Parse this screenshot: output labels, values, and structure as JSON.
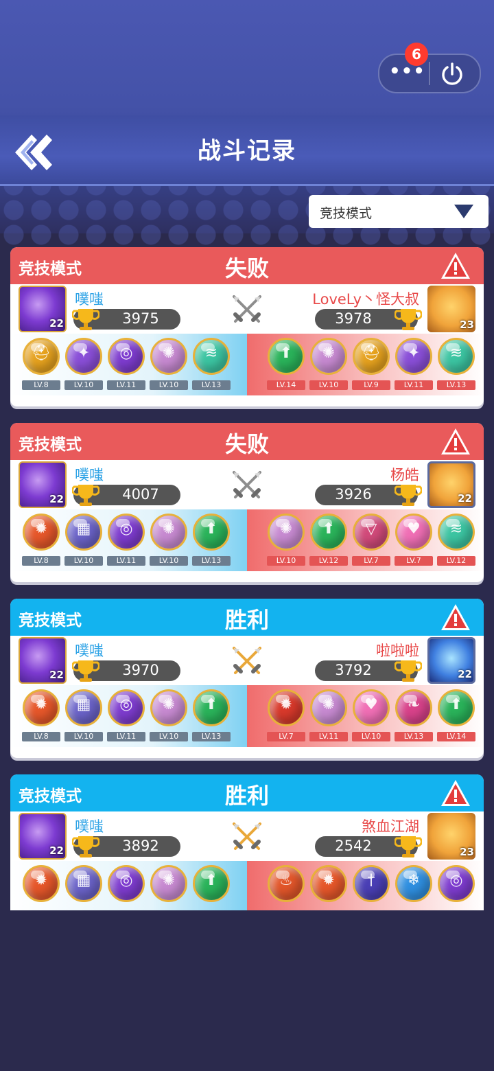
{
  "header": {
    "title": "战斗记录",
    "badge_count": "6"
  },
  "filter": {
    "selected": "竞技模式"
  },
  "colors": {
    "lose": "#e95a5b",
    "win": "#13b3ef"
  },
  "matches": [
    {
      "mode": "竞技模式",
      "result": "失败",
      "outcome": "lose",
      "me": {
        "name": "噗嗤",
        "trophies": "3975",
        "level": "22",
        "avatar": "purple-orb"
      },
      "opponent": {
        "name": "LoveLy丶怪大叔",
        "trophies": "3978",
        "level": "23",
        "avatar": "tiger"
      },
      "my_pets": [
        {
          "icon": "gold-helmet",
          "color": "#e6a21e",
          "lv": "LV.8"
        },
        {
          "icon": "purple-butterfly",
          "color": "#8a4fd8",
          "lv": "LV.10"
        },
        {
          "icon": "purple-swirl",
          "color": "#7e3ccf",
          "lv": "LV.11"
        },
        {
          "icon": "rainbow-figure",
          "color": "#c78ad1",
          "lv": "LV.10"
        },
        {
          "icon": "green-tornado",
          "color": "#3cc5a2",
          "lv": "LV.13"
        }
      ],
      "opp_pets": [
        {
          "icon": "green-arrow",
          "color": "#2ab35a",
          "lv": "LV.14"
        },
        {
          "icon": "rainbow-figure",
          "color": "#c78ad1",
          "lv": "LV.10"
        },
        {
          "icon": "gold-helmet",
          "color": "#e6a21e",
          "lv": "LV.9"
        },
        {
          "icon": "purple-butterfly",
          "color": "#8a4fd8",
          "lv": "LV.11"
        },
        {
          "icon": "green-tornado",
          "color": "#3cc5a2",
          "lv": "LV.13"
        }
      ]
    },
    {
      "mode": "竞技模式",
      "result": "失败",
      "outcome": "lose",
      "me": {
        "name": "噗嗤",
        "trophies": "4007",
        "level": "22",
        "avatar": "purple-orb"
      },
      "opponent": {
        "name": "杨皓",
        "trophies": "3926",
        "level": "22",
        "avatar": "tiger-framed"
      },
      "my_pets": [
        {
          "icon": "fire-phoenix",
          "color": "#e6572a",
          "lv": "LV.8"
        },
        {
          "icon": "stone-block",
          "color": "#6b63c9",
          "lv": "LV.10"
        },
        {
          "icon": "purple-swirl",
          "color": "#7e3ccf",
          "lv": "LV.11"
        },
        {
          "icon": "rainbow-figure",
          "color": "#c78ad1",
          "lv": "LV.10"
        },
        {
          "icon": "green-arrow",
          "color": "#2ab35a",
          "lv": "LV.13"
        }
      ],
      "opp_pets": [
        {
          "icon": "rainbow-figure",
          "color": "#c78ad1",
          "lv": "LV.10"
        },
        {
          "icon": "green-arrow",
          "color": "#2ab35a",
          "lv": "LV.12"
        },
        {
          "icon": "prism",
          "color": "#d14a7a",
          "lv": "LV.7"
        },
        {
          "icon": "pink-heart",
          "color": "#f06fb5",
          "lv": "LV.7"
        },
        {
          "icon": "green-tornado",
          "color": "#3cc5a2",
          "lv": "LV.12"
        }
      ]
    },
    {
      "mode": "竞技模式",
      "result": "胜利",
      "outcome": "win",
      "me": {
        "name": "噗嗤",
        "trophies": "3970",
        "level": "22",
        "avatar": "purple-orb"
      },
      "opponent": {
        "name": "啦啦啦",
        "trophies": "3792",
        "level": "22",
        "avatar": "ice-crystal"
      },
      "my_pets": [
        {
          "icon": "fire-phoenix",
          "color": "#e6572a",
          "lv": "LV.8"
        },
        {
          "icon": "stone-block",
          "color": "#6b63c9",
          "lv": "LV.10"
        },
        {
          "icon": "purple-swirl",
          "color": "#7e3ccf",
          "lv": "LV.11"
        },
        {
          "icon": "rainbow-figure",
          "color": "#c78ad1",
          "lv": "LV.10"
        },
        {
          "icon": "green-arrow",
          "color": "#2ab35a",
          "lv": "LV.13"
        }
      ],
      "opp_pets": [
        {
          "icon": "red-phoenix",
          "color": "#d8392b",
          "lv": "LV.7"
        },
        {
          "icon": "rainbow-figure",
          "color": "#c78ad1",
          "lv": "LV.11"
        },
        {
          "icon": "pink-heart",
          "color": "#f06fb5",
          "lv": "LV.10"
        },
        {
          "icon": "pink-wing",
          "color": "#d8428a",
          "lv": "LV.13"
        },
        {
          "icon": "green-arrow",
          "color": "#2ab35a",
          "lv": "LV.14"
        }
      ]
    },
    {
      "mode": "竞技模式",
      "result": "胜利",
      "outcome": "win",
      "me": {
        "name": "噗嗤",
        "trophies": "3892",
        "level": "22",
        "avatar": "purple-orb"
      },
      "opponent": {
        "name": "煞血江湖",
        "trophies": "2542",
        "level": "23",
        "avatar": "tiger"
      },
      "my_pets": [
        {
          "icon": "fire-phoenix",
          "color": "#e6572a",
          "lv": ""
        },
        {
          "icon": "stone-block",
          "color": "#6b63c9",
          "lv": ""
        },
        {
          "icon": "purple-swirl",
          "color": "#7e3ccf",
          "lv": ""
        },
        {
          "icon": "rainbow-figure",
          "color": "#c78ad1",
          "lv": ""
        },
        {
          "icon": "green-arrow",
          "color": "#2ab35a",
          "lv": ""
        }
      ],
      "opp_pets": [
        {
          "icon": "fire-wings",
          "color": "#e2562a",
          "lv": ""
        },
        {
          "icon": "fire-phoenix",
          "color": "#e6572a",
          "lv": ""
        },
        {
          "icon": "blue-sword",
          "color": "#4a3fb5",
          "lv": ""
        },
        {
          "icon": "snowflake",
          "color": "#2f8fe0",
          "lv": ""
        },
        {
          "icon": "purple-swirl",
          "color": "#7e3ccf",
          "lv": ""
        }
      ]
    }
  ]
}
